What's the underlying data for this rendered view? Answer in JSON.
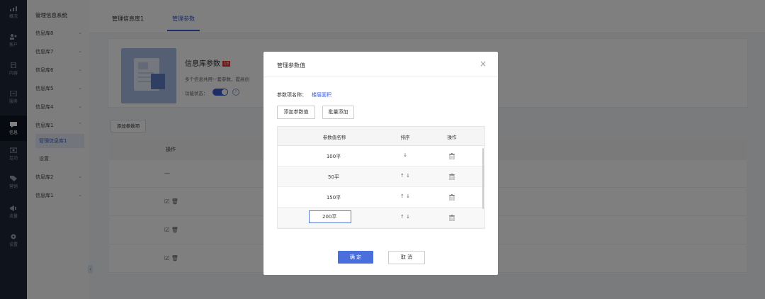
{
  "rail": {
    "items": [
      {
        "label": "概况",
        "icon": "chart-icon"
      },
      {
        "label": "客户",
        "icon": "users-icon"
      },
      {
        "label": "内容",
        "icon": "document-icon"
      },
      {
        "label": "服务",
        "icon": "service-icon"
      },
      {
        "label": "信息",
        "icon": "message-icon",
        "active": true
      },
      {
        "label": "互动",
        "icon": "interact-icon"
      },
      {
        "label": "营销",
        "icon": "tag-icon"
      },
      {
        "label": "流量",
        "icon": "traffic-icon"
      },
      {
        "label": "设置",
        "icon": "gear-icon"
      }
    ]
  },
  "subnav": {
    "title": "管理信息系统",
    "items": [
      "信息库8",
      "信息库7",
      "信息库6",
      "信息库5",
      "信息库4",
      "信息库1"
    ],
    "sub_items": [
      "管理信息库1",
      "设置"
    ],
    "after_items": [
      "信息库2",
      "信息库1"
    ],
    "collapse_label": "‹"
  },
  "tabs": [
    "管理信息库1",
    "管理参数"
  ],
  "card": {
    "title": "信息库参数",
    "badge": "18",
    "desc": "多个信息共用一套参数，提高创",
    "status_label": "功能状态：",
    "help": "?"
  },
  "bg": {
    "add_button": "添加参数项",
    "header_ops": "操作",
    "row1": "—",
    "row_icons": "☑ 🗑"
  },
  "modal": {
    "title": "管理参数值",
    "close": "×",
    "param_label": "参数项名称：",
    "param_value": "楼层面积",
    "add_value_button": "添加参数值",
    "batch_add_button": "批量添加",
    "table_headers": [
      "参数值名称",
      "排序",
      "操作"
    ],
    "rows": [
      {
        "name": "100平",
        "sort": "↓"
      },
      {
        "name": "50平",
        "sort": "↑  ↓"
      },
      {
        "name": "150平",
        "sort": "↑  ↓"
      }
    ],
    "editing_row": {
      "value": "200平",
      "sort": "↑  ↓"
    },
    "ok_button": "确 定",
    "cancel_button": "取 消"
  }
}
